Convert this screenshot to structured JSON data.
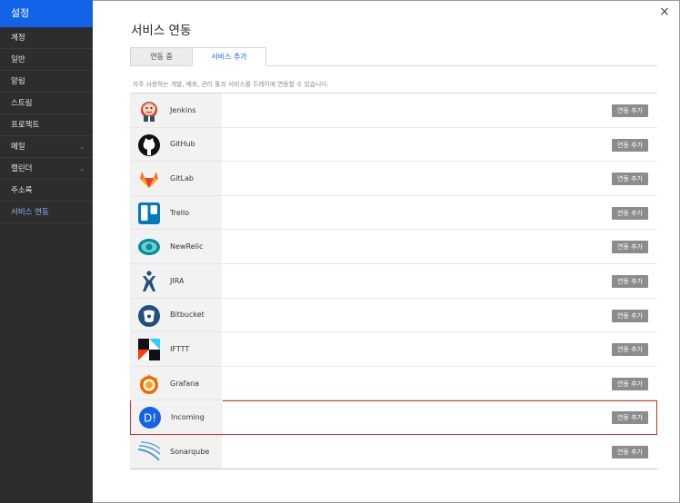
{
  "sidebar": {
    "title": "설정",
    "items": [
      {
        "label": "계정",
        "has_chevron": false,
        "active": false
      },
      {
        "label": "일반",
        "has_chevron": false,
        "active": false
      },
      {
        "label": "알림",
        "has_chevron": false,
        "active": false
      },
      {
        "label": "스트림",
        "has_chevron": false,
        "active": false
      },
      {
        "label": "프로젝트",
        "has_chevron": false,
        "active": false
      },
      {
        "label": "메일",
        "has_chevron": true,
        "active": false
      },
      {
        "label": "캘린더",
        "has_chevron": true,
        "active": false
      },
      {
        "label": "주소록",
        "has_chevron": false,
        "active": false
      },
      {
        "label": "서비스 연동",
        "has_chevron": false,
        "active": true
      }
    ]
  },
  "header": {
    "title": "서비스 연동",
    "close_icon": "×"
  },
  "tabs": [
    {
      "label": "연동 중",
      "selected": false
    },
    {
      "label": "서비스 추가",
      "selected": true
    }
  ],
  "description": "자주 사용하는 개발, 배포, 관리 툴과 서비스를 두레이에 연동할 수 있습니다.",
  "services": [
    {
      "name": "Jenkins",
      "icon": "jenkins-icon",
      "button": "연동 추가",
      "highlighted": false
    },
    {
      "name": "GitHub",
      "icon": "github-icon",
      "button": "연동 추가",
      "highlighted": false
    },
    {
      "name": "GitLab",
      "icon": "gitlab-icon",
      "button": "연동 추가",
      "highlighted": false
    },
    {
      "name": "Trello",
      "icon": "trello-icon",
      "button": "연동 추가",
      "highlighted": false
    },
    {
      "name": "NewRelic",
      "icon": "newrelic-icon",
      "button": "연동 추가",
      "highlighted": false
    },
    {
      "name": "JIRA",
      "icon": "jira-icon",
      "button": "연동 추가",
      "highlighted": false
    },
    {
      "name": "Bitbucket",
      "icon": "bitbucket-icon",
      "button": "연동 추가",
      "highlighted": false
    },
    {
      "name": "IFTTT",
      "icon": "ifttt-icon",
      "button": "연동 추가",
      "highlighted": false
    },
    {
      "name": "Grafana",
      "icon": "grafana-icon",
      "button": "연동 추가",
      "highlighted": false
    },
    {
      "name": "Incoming",
      "icon": "incoming-icon",
      "button": "연동 추가",
      "highlighted": true
    },
    {
      "name": "Sonarqube",
      "icon": "sonarqube-icon",
      "button": "연동 추가",
      "highlighted": false
    }
  ],
  "colors": {
    "brand": "#1263e8",
    "sidebar_bg": "#2d2d2d",
    "button_bg": "#8c8c8c",
    "highlight_border": "#c83232"
  }
}
